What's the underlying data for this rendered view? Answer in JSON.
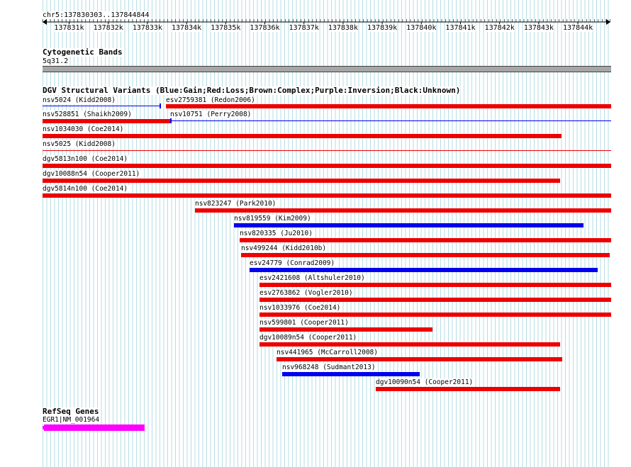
{
  "coordinates": "chr5:137830303..137844844",
  "ruler": {
    "ticks": [
      "137831k",
      "137832k",
      "137833k",
      "137834k",
      "137835k",
      "137836k",
      "137837k",
      "137838k",
      "137839k",
      "137840k",
      "137841k",
      "137842k",
      "137843k",
      "137844k"
    ]
  },
  "tracks": {
    "cytoband": {
      "title": "Cytogenetic Bands",
      "band": "5q31.2"
    },
    "dgv": {
      "title": "DGV Structural Variants (Blue:Gain;Red:Loss;Brown:Complex;Purple:Inversion;Black:Unknown)",
      "colors": {
        "gain": "#0000ee",
        "loss": "#ee0000"
      },
      "variants": [
        {
          "id": "nsv5024",
          "label": "nsv5024 (Kidd2008)"
        },
        {
          "id": "esv2759381",
          "label": "esv2759381 (Redon2006)"
        },
        {
          "id": "nsv528851",
          "label": "nsv528851 (Shaikh2009)"
        },
        {
          "id": "nsv10751",
          "label": "nsv10751 (Perry2008)"
        },
        {
          "id": "nsv1034030",
          "label": "nsv1034030 (Coe2014)"
        },
        {
          "id": "nsv5025",
          "label": "nsv5025 (Kidd2008)"
        },
        {
          "id": "dgv5813n100",
          "label": "dgv5813n100 (Coe2014)"
        },
        {
          "id": "dgv10088n54",
          "label": "dgv10088n54 (Cooper2011)"
        },
        {
          "id": "dgv5814n100",
          "label": "dgv5814n100 (Coe2014)"
        },
        {
          "id": "nsv823247",
          "label": "nsv823247 (Park2010)"
        },
        {
          "id": "nsv819559",
          "label": "nsv819559 (Kim2009)"
        },
        {
          "id": "nsv820335",
          "label": "nsv820335 (Ju2010)"
        },
        {
          "id": "nsv499244",
          "label": "nsv499244 (Kidd2010b)"
        },
        {
          "id": "esv24779",
          "label": "esv24779 (Conrad2009)"
        },
        {
          "id": "esv2421608",
          "label": "esv2421608 (Altshuler2010)"
        },
        {
          "id": "esv2763862",
          "label": "esv2763862 (Vogler2010)"
        },
        {
          "id": "nsv1033976",
          "label": "nsv1033976 (Coe2014)"
        },
        {
          "id": "nsv599801",
          "label": "nsv599801 (Cooper2011)"
        },
        {
          "id": "dgv10089n54",
          "label": "dgv10089n54 (Cooper2011)"
        },
        {
          "id": "nsv441965",
          "label": "nsv441965 (McCarroll2008)"
        },
        {
          "id": "nsv968248",
          "label": "nsv968248 (Sudmant2013)"
        },
        {
          "id": "dgv10090n54",
          "label": "dgv10090n54 (Cooper2011)"
        }
      ]
    },
    "refseq": {
      "title": "RefSeq Genes",
      "gene": "EGR1|NM_001964",
      "color": "#ff00ff"
    }
  }
}
